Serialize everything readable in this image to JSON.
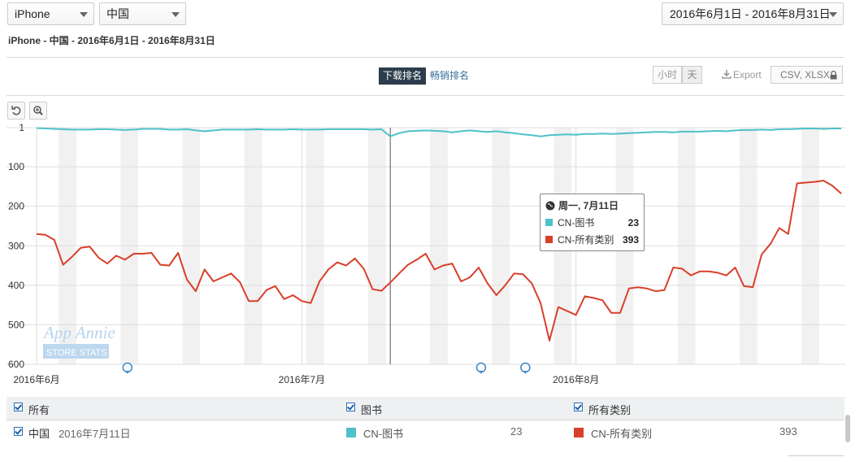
{
  "filters": {
    "device": "iPhone",
    "country": "中国",
    "date_range": "2016年6月1日 - 2016年8月31日"
  },
  "subtitle": "iPhone - 中国 - 2016年6月1日 - 2016年8月31日",
  "tabs": {
    "downloads": "下载排名",
    "grossing": "畅销排名"
  },
  "granularity": {
    "hour": "小时",
    "day": "天"
  },
  "export": {
    "label": "Export",
    "formats": "CSV, XLSX"
  },
  "watermark": {
    "brand": "App Annie",
    "tag": "STORE STATS"
  },
  "tooltip": {
    "date": "周一, 7月11日",
    "rows": [
      {
        "label": "CN-图书",
        "value": "23"
      },
      {
        "label": "CN-所有类别",
        "value": "393"
      }
    ]
  },
  "legend": {
    "all": "所有",
    "books": "图书",
    "all_categories": "所有类别",
    "country": "中国",
    "date": "2016年7月11日",
    "book_series": "CN-图书",
    "book_value": "23",
    "all_series": "CN-所有类别",
    "all_value": "393"
  },
  "chart_data": {
    "type": "line",
    "y_axis": {
      "reversed": true,
      "min": 1,
      "max": 600,
      "ticks": [
        "1",
        "100",
        "200",
        "300",
        "400",
        "500",
        "600"
      ]
    },
    "x_labels": [
      "2016年6月",
      "2016年7月",
      "2016年8月"
    ],
    "x_start": "2016-06-01",
    "x_end": "2016-08-31",
    "weekend_bands": true,
    "crosshair_date": "2016-07-11",
    "series": [
      {
        "name": "CN-图书",
        "color": "#4fc1c9",
        "values": [
          2,
          3,
          4,
          5,
          6,
          6,
          6,
          5,
          5,
          6,
          7,
          6,
          4,
          4,
          4,
          6,
          6,
          5,
          8,
          10,
          8,
          6,
          6,
          6,
          6,
          5,
          6,
          6,
          6,
          5,
          6,
          6,
          6,
          5,
          5,
          5,
          5,
          5,
          6,
          5,
          23,
          15,
          10,
          9,
          8,
          9,
          10,
          13,
          10,
          8,
          10,
          12,
          10,
          13,
          15,
          18,
          20,
          23,
          20,
          19,
          18,
          19,
          17,
          17,
          16,
          17,
          16,
          15,
          14,
          13,
          12,
          12,
          13,
          11,
          11,
          11,
          10,
          9,
          10,
          8,
          7,
          7,
          6,
          7,
          5,
          5,
          4,
          3,
          3,
          4,
          3,
          3
        ]
      },
      {
        "name": "CN-所有类别",
        "color": "#d8402a",
        "values": [
          270,
          272,
          285,
          348,
          328,
          305,
          302,
          330,
          345,
          325,
          335,
          320,
          320,
          318,
          348,
          350,
          318,
          385,
          415,
          360,
          390,
          380,
          370,
          392,
          440,
          440,
          412,
          402,
          435,
          425,
          440,
          445,
          390,
          360,
          342,
          350,
          332,
          358,
          410,
          414,
          393,
          370,
          348,
          335,
          320,
          360,
          350,
          345,
          390,
          380,
          355,
          395,
          425,
          400,
          370,
          372,
          395,
          445,
          540,
          455,
          465,
          475,
          428,
          432,
          438,
          470,
          470,
          408,
          405,
          408,
          415,
          412,
          355,
          358,
          375,
          365,
          365,
          368,
          375,
          355,
          402,
          405,
          322,
          295,
          255,
          270,
          142,
          140,
          138,
          135,
          148,
          168
        ]
      }
    ]
  }
}
